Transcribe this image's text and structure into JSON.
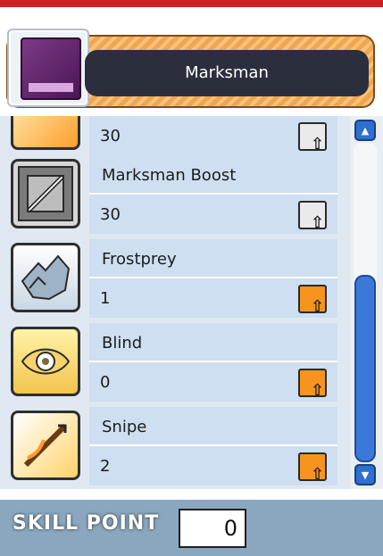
{
  "job": {
    "name": "Marksman"
  },
  "skills": [
    {
      "name": "",
      "level": "30"
    },
    {
      "name": "Marksman Boost",
      "level": "30"
    },
    {
      "name": "Frostprey",
      "level": "1"
    },
    {
      "name": "Blind",
      "level": "0"
    },
    {
      "name": "Snipe",
      "level": "2"
    }
  ],
  "footer": {
    "label": "SKILL POINT",
    "value": "0"
  },
  "colors": {
    "accent": "#f7941d",
    "header_bar": "#d21f1f",
    "scrollbar": "#3b79d9"
  }
}
